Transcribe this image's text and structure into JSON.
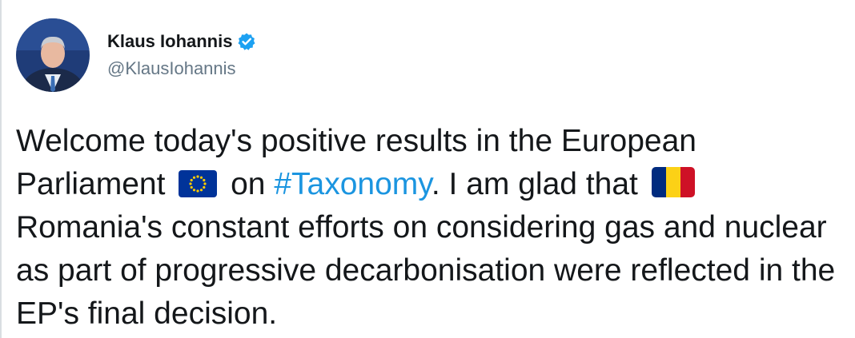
{
  "author": {
    "display_name": "Klaus Iohannis",
    "handle": "@KlausIohannis",
    "verified": true,
    "avatar_icon": "person-portrait-icon"
  },
  "tweet": {
    "segment_1": "Welcome today's positive results in the European Parliament",
    "flag_1": "eu-flag-icon",
    "segment_2": "on",
    "hashtag": "#Taxonomy",
    "segment_3": ". I am glad that",
    "flag_2": "romania-flag-icon",
    "segment_4": "Romania's constant efforts on considering gas and nuclear as part of progressive decarbonisation were reflected in the EP's final decision."
  },
  "colors": {
    "text": "#14171a",
    "secondary": "#657786",
    "link": "#1b95e0",
    "verified": "#1da1f2",
    "eu_blue": "#003399",
    "eu_gold": "#ffcc00",
    "ro_blue": "#002b7f",
    "ro_yellow": "#fcd116",
    "ro_red": "#ce1126"
  }
}
